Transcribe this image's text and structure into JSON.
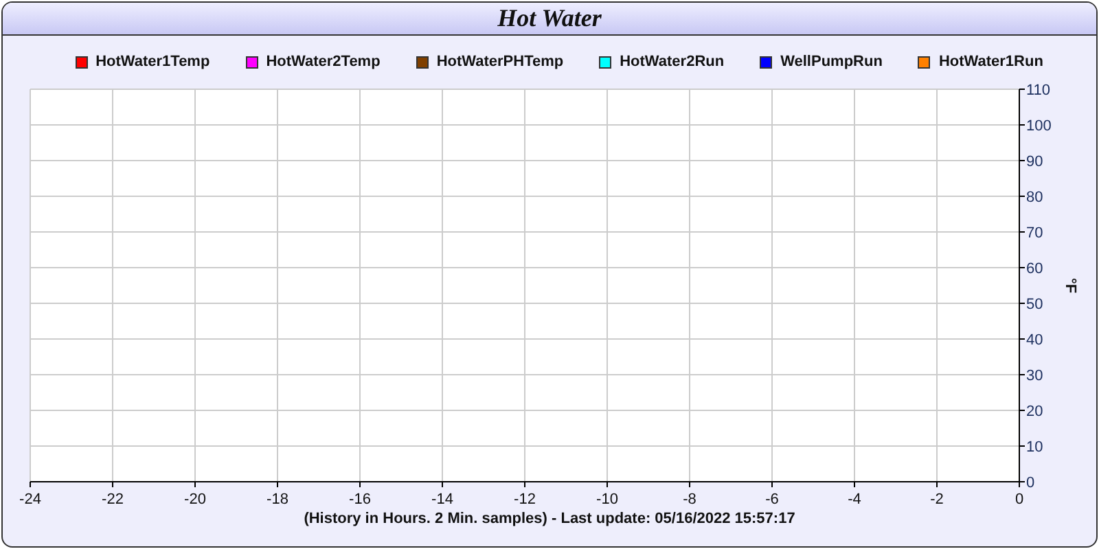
{
  "window": {
    "title": "Hot Water"
  },
  "chart": {
    "chart_data": {
      "type": "line",
      "ylabel": "°F",
      "xlabel": "(History in Hours. 2 Min. samples) - Last update: 05/16/2022 15:57:17",
      "ylim": [
        0,
        110
      ],
      "grid": true,
      "categories": [
        "-24",
        "-22",
        "-20",
        "-18",
        "-16",
        "-14",
        "-12",
        "-10",
        "-8",
        "-6",
        "-4",
        "-2",
        "0"
      ],
      "yticks": [
        0,
        10,
        20,
        30,
        40,
        50,
        60,
        70,
        80,
        90,
        100,
        110
      ],
      "series": [
        {
          "name": "HotWater1Temp",
          "color": "#ff0000",
          "values": [
            null,
            null,
            null,
            null,
            null,
            null,
            null,
            null,
            null,
            null,
            null,
            null,
            null
          ]
        },
        {
          "name": "HotWater2Temp",
          "color": "#ff00ff",
          "values": [
            null,
            null,
            null,
            null,
            null,
            null,
            null,
            null,
            null,
            null,
            null,
            null,
            null
          ]
        },
        {
          "name": "HotWaterPHTemp",
          "color": "#7f3f00",
          "values": [
            null,
            null,
            null,
            null,
            null,
            null,
            null,
            null,
            null,
            null,
            null,
            null,
            null
          ]
        },
        {
          "name": "HotWater2Run",
          "color": "#00ffff",
          "values": [
            null,
            null,
            null,
            null,
            null,
            null,
            null,
            null,
            null,
            null,
            null,
            null,
            null
          ]
        },
        {
          "name": "WellPumpRun",
          "color": "#0000ff",
          "values": [
            null,
            null,
            null,
            null,
            null,
            null,
            null,
            null,
            null,
            null,
            null,
            null,
            null
          ]
        },
        {
          "name": "HotWater1Run",
          "color": "#ff8000",
          "values": [
            null,
            null,
            null,
            null,
            null,
            null,
            null,
            null,
            null,
            null,
            null,
            null,
            null
          ]
        }
      ]
    }
  }
}
